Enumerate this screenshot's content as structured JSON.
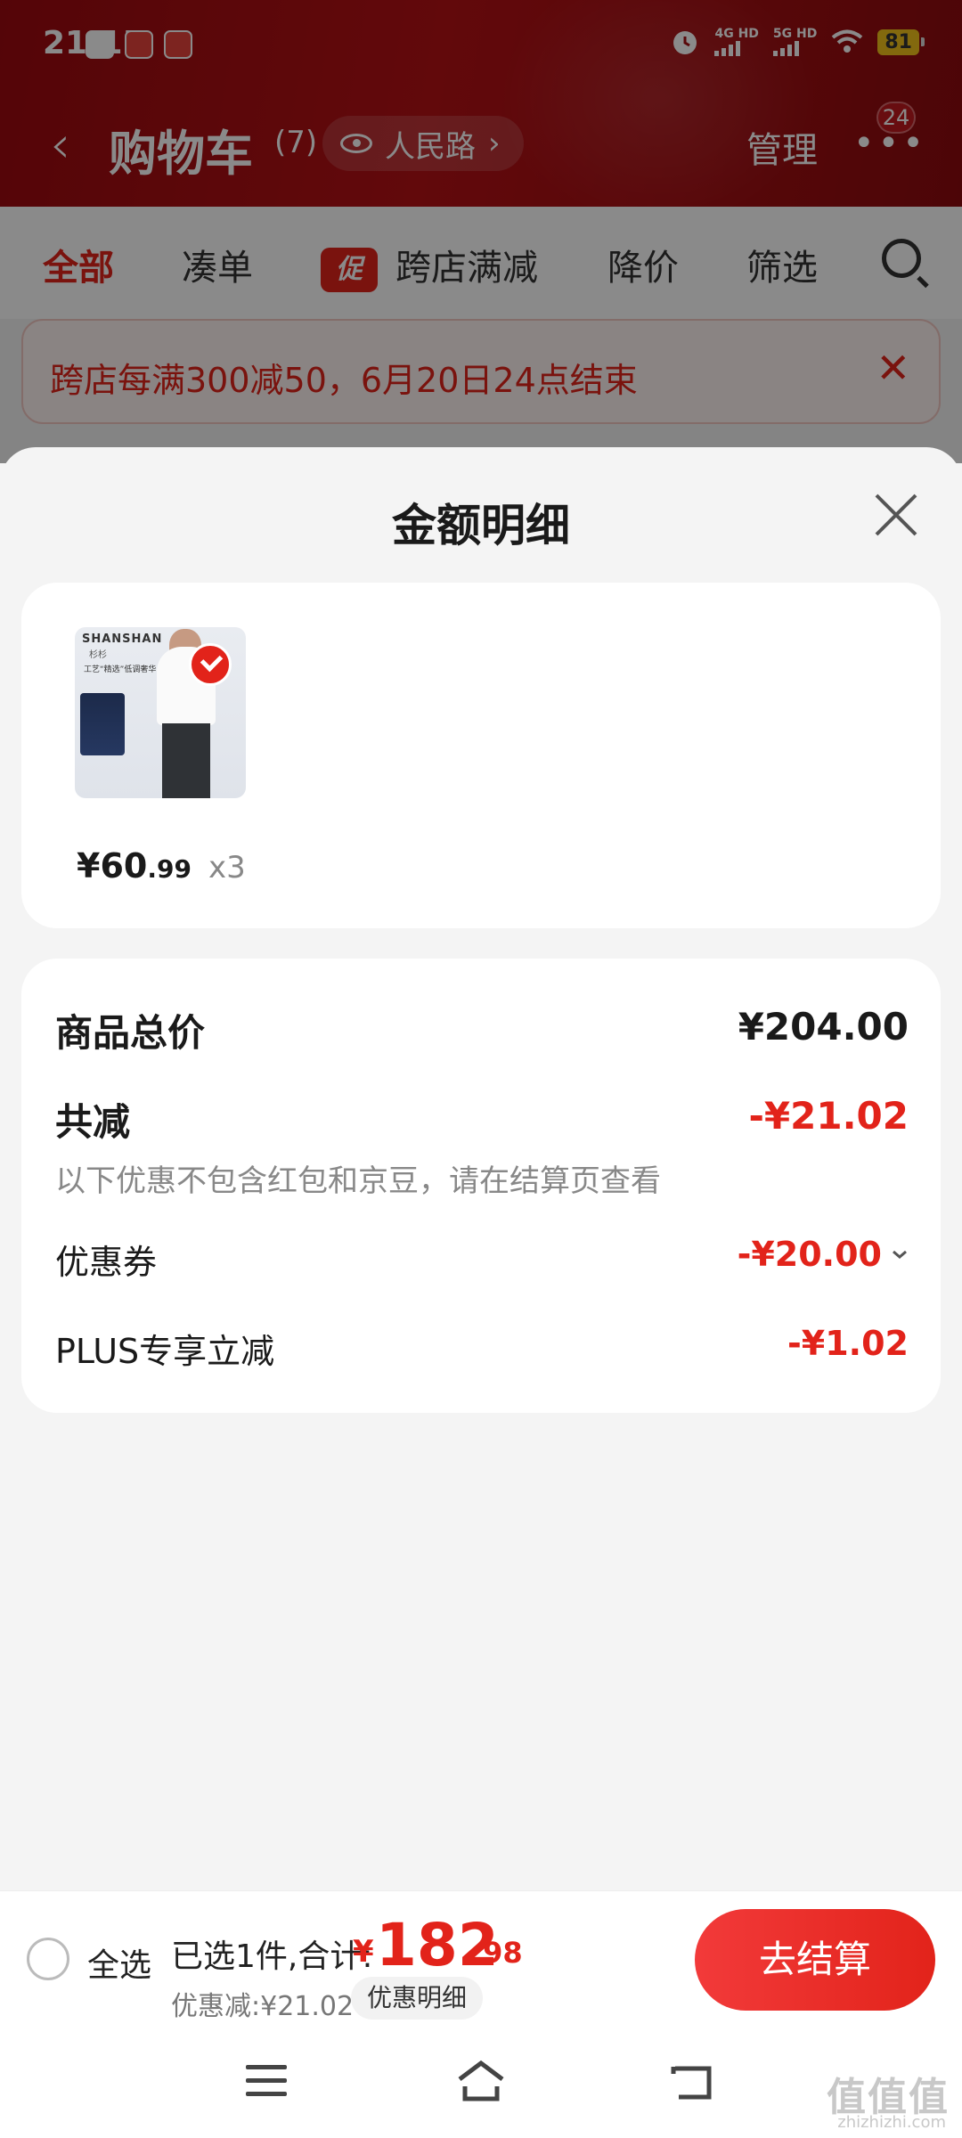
{
  "status_bar": {
    "time": "21:15",
    "sig1_label": "4G HD",
    "sig2_label": "5G HD",
    "battery": "81"
  },
  "nav": {
    "back_icon": "chevron-left-icon",
    "title": "购物车",
    "count": "(7)",
    "location": "人民路",
    "location_arrow": "›",
    "manage": "管理",
    "more_badge": "24"
  },
  "tabs": {
    "all": "全部",
    "bundle": "凑单",
    "promo_tag": "促",
    "cross_store": "跨店满减",
    "price_drop": "降价",
    "filter": "筛选"
  },
  "notice": {
    "text": "跨店每满300减50，6月20日24点结束",
    "close": "✕"
  },
  "sheet": {
    "title": "金额明细",
    "item": {
      "brand": "SHANSHAN",
      "brand_cn": "杉杉",
      "image_caption": "工艺“精选”低调奢华",
      "price_int": "¥60",
      "price_dec": ".99",
      "qty": "x3"
    },
    "summary": {
      "total_label": "商品总价",
      "total_value": "¥204.00",
      "reduce_label": "共减",
      "reduce_value": "-¥21.02",
      "note": "以下优惠不包含红包和京豆，请在结算页查看",
      "coupon_label": "优惠券",
      "coupon_value": "-¥20.00",
      "plus_label": "PLUS专享立减",
      "plus_value": "-¥1.02"
    }
  },
  "footer": {
    "select_all": "全选",
    "selected": "已选1件,合计:",
    "yen": "¥",
    "total_int": "182",
    "total_dec": ".98",
    "discount": "优惠减:¥21.02",
    "detail_btn": "优惠明细",
    "checkout": "去结算"
  },
  "watermark": {
    "logo": "值值值",
    "site": "zhizhizhi.com"
  },
  "colors": {
    "accent": "#e2231a",
    "header": "#a50e12"
  }
}
